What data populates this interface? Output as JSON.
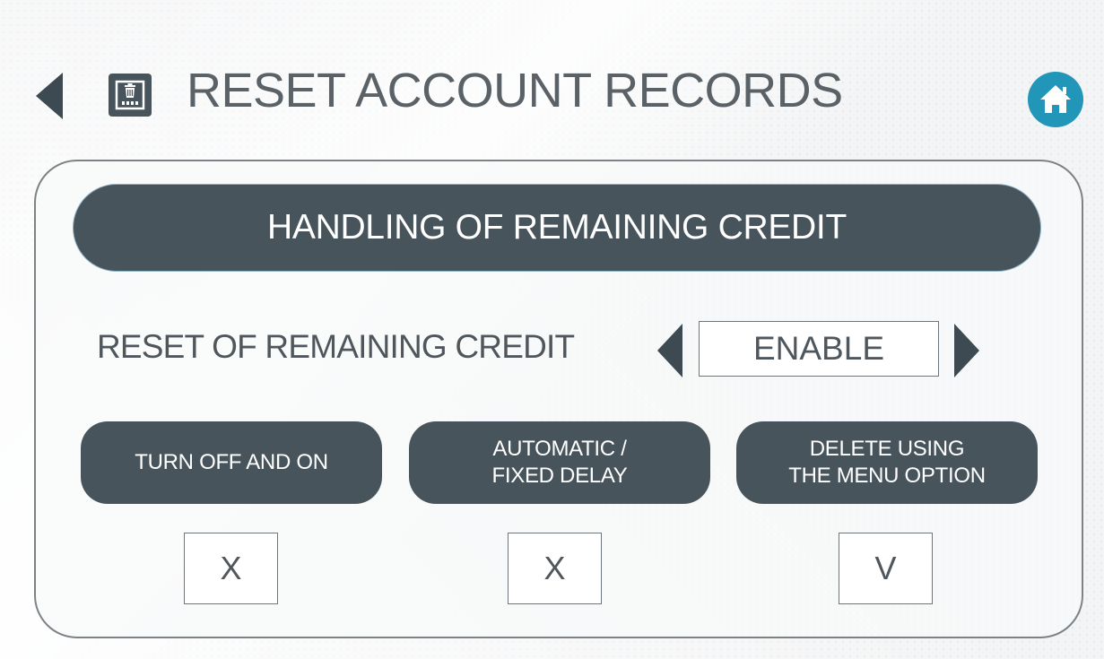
{
  "header": {
    "title": "RESET ACCOUNT RECORDS",
    "back_icon": "back-arrow-icon",
    "title_icon": "trash-card-icon",
    "home_icon": "home-icon",
    "home_color": "#2196b8"
  },
  "section": {
    "title": "HANDLING OF REMAINING CREDIT"
  },
  "setting": {
    "label": "RESET OF REMAINING CREDIT",
    "value": "ENABLE"
  },
  "options": [
    {
      "line1": "TURN OFF AND ON",
      "line2": "",
      "state": "X"
    },
    {
      "line1": "AUTOMATIC /",
      "line2": "FIXED DELAY",
      "state": "X"
    },
    {
      "line1": "DELETE USING",
      "line2": "THE MENU OPTION",
      "state": "V"
    }
  ],
  "colors": {
    "button_bg": "#48545c",
    "text": "#4f575d"
  }
}
